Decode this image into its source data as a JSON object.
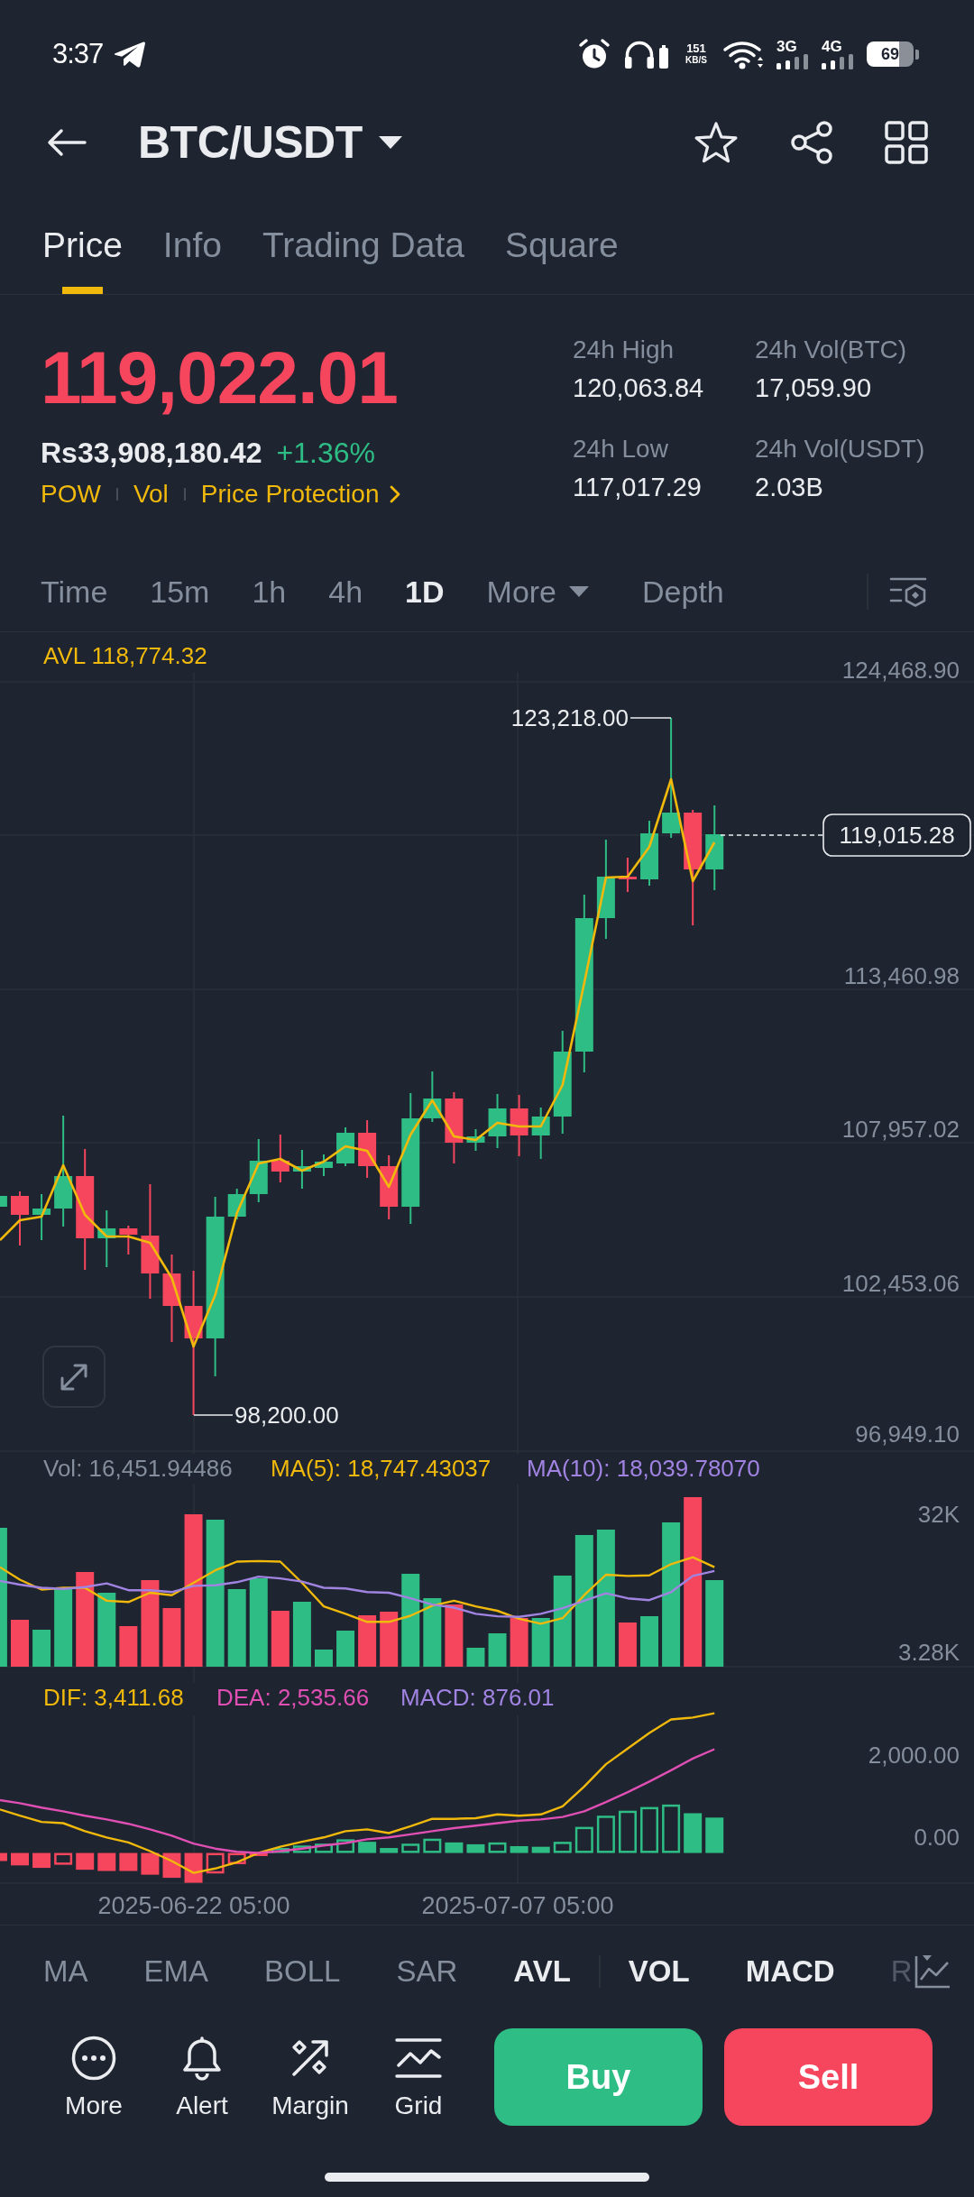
{
  "status_bar": {
    "time": "3:37",
    "net_speed": "151",
    "net_unit": "KB/S",
    "networks": [
      "3G",
      "4G"
    ],
    "battery": "69"
  },
  "header": {
    "title": "BTC/USDT"
  },
  "tabs": [
    {
      "label": "Price",
      "selected": true
    },
    {
      "label": "Info",
      "selected": false
    },
    {
      "label": "Trading Data",
      "selected": false
    },
    {
      "label": "Square",
      "selected": false
    }
  ],
  "ticker": {
    "price": "119,022.01",
    "fiat_price": "Rs33,908,180.42",
    "change": "+1.36%",
    "tags": [
      {
        "label": "POW",
        "kind": "tag"
      },
      {
        "label": "Vol",
        "kind": "tag"
      },
      {
        "label": "Price Protection",
        "kind": "link"
      }
    ],
    "stats": [
      {
        "label": "24h High",
        "value": "120,063.84"
      },
      {
        "label": "24h Vol(BTC)",
        "value": "17,059.90"
      },
      {
        "label": "24h Low",
        "value": "117,017.29"
      },
      {
        "label": "24h Vol(USDT)",
        "value": "2.03B"
      }
    ]
  },
  "intervals": [
    {
      "label": "Time",
      "kind": "option",
      "selected": false
    },
    {
      "label": "15m",
      "kind": "option",
      "selected": false
    },
    {
      "label": "1h",
      "kind": "option",
      "selected": false
    },
    {
      "label": "4h",
      "kind": "option",
      "selected": false
    },
    {
      "label": "1D",
      "kind": "option",
      "selected": true
    },
    {
      "label": "More",
      "kind": "dropdown",
      "selected": false
    },
    {
      "label": "Depth",
      "kind": "option",
      "selected": false
    }
  ],
  "price_chart": {
    "indicator": "AVL 118,774.32",
    "y_axis": [
      "124,468.90",
      "113,460.98",
      "107,957.02",
      "102,453.06",
      "96,949.10"
    ],
    "high_label": "123,218.00",
    "low_label": "98,200.00",
    "last_price": "119,015.28"
  },
  "volume_chart": {
    "legend": [
      {
        "text": "Vol: 16,451.94486",
        "color": "#848e9c"
      },
      {
        "text": "MA(5): 18,747.43037",
        "color": "#f0b90b"
      },
      {
        "text": "MA(10): 18,039.78070",
        "color": "#a183e2"
      }
    ],
    "y_axis": [
      "32K",
      "3.28K"
    ]
  },
  "macd_chart": {
    "legend": [
      {
        "text": "DIF: 3,411.68",
        "color": "#f0b90b"
      },
      {
        "text": "DEA: 2,535.66",
        "color": "#e04fb3"
      },
      {
        "text": "MACD: 876.01",
        "color": "#a183e2"
      }
    ],
    "y_axis": [
      "2,000.00",
      "0.00"
    ]
  },
  "x_axis": [
    "2025-06-22 05:00",
    "2025-07-07 05:00"
  ],
  "main_indicators": [
    {
      "label": "MA",
      "selected": false
    },
    {
      "label": "EMA",
      "selected": false
    },
    {
      "label": "BOLL",
      "selected": false
    },
    {
      "label": "SAR",
      "selected": false
    },
    {
      "label": "AVL",
      "selected": true
    }
  ],
  "sub_indicators": [
    {
      "label": "VOL",
      "selected": true
    },
    {
      "label": "MACD",
      "selected": true
    },
    {
      "label": "R",
      "selected": false
    }
  ],
  "actions": [
    {
      "label": "More",
      "kind": "more"
    },
    {
      "label": "Alert",
      "kind": "alert"
    },
    {
      "label": "Margin",
      "kind": "margin"
    },
    {
      "label": "Grid",
      "kind": "grid"
    }
  ],
  "trade_buttons": [
    {
      "label": "Buy",
      "kind": "buy"
    },
    {
      "label": "Sell",
      "kind": "sell"
    }
  ]
}
